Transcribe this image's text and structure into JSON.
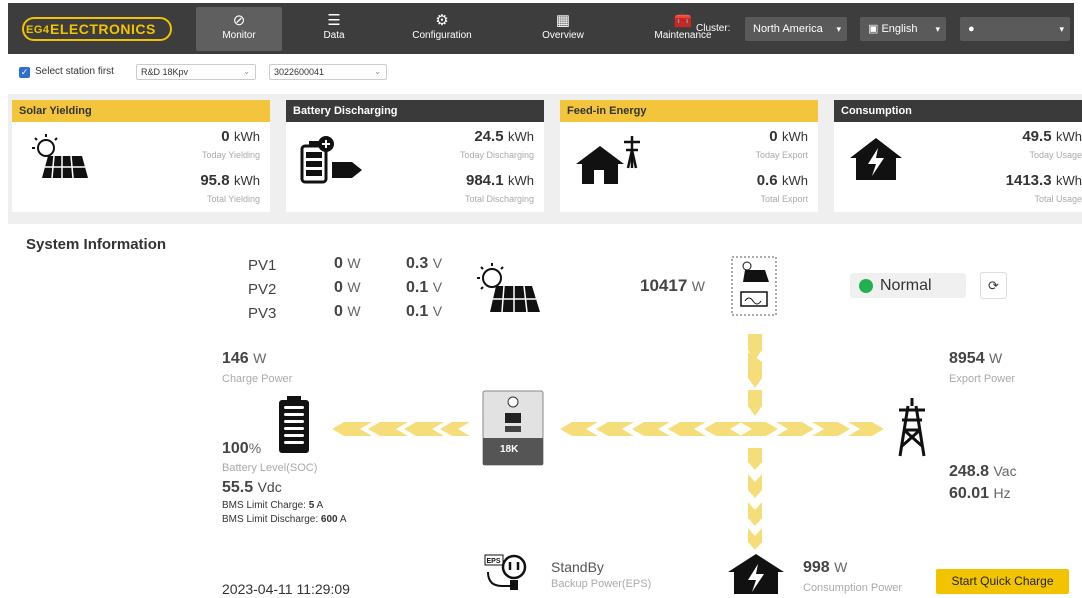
{
  "header": {
    "logo": "ELECTRONICS",
    "logo_mark": "EG4",
    "nav": [
      {
        "label": "Monitor",
        "icon": "⊘"
      },
      {
        "label": "Data",
        "icon": "☰"
      },
      {
        "label": "Configuration",
        "icon": "⚙"
      },
      {
        "label": "Overview",
        "icon": "▦"
      },
      {
        "label": "Maintenance",
        "icon": "🧰"
      }
    ],
    "cluster_label": "Cluster:",
    "cluster_value": "North America",
    "language": "English",
    "account": ""
  },
  "station": {
    "checkbox_label": "Select station first",
    "station": "R&D 18Kpv",
    "serial": "3022600041"
  },
  "cards": [
    {
      "title": "Solar Yielding",
      "today": "0",
      "today_unit": "kWh",
      "today_label": "Today Yielding",
      "total": "95.8",
      "total_unit": "kWh",
      "total_label": "Total Yielding",
      "icon": "solar-panel-icon"
    },
    {
      "title": "Battery Discharging",
      "today": "24.5",
      "today_unit": "kWh",
      "today_label": "Today Discharging",
      "total": "984.1",
      "total_unit": "kWh",
      "total_label": "Total Discharging",
      "icon": "battery-icon"
    },
    {
      "title": "Feed-in Energy",
      "today": "0",
      "today_unit": "kWh",
      "today_label": "Today Export",
      "total": "0.6",
      "total_unit": "kWh",
      "total_label": "Total Export",
      "icon": "house-grid-icon"
    },
    {
      "title": "Consumption",
      "today": "49.5",
      "today_unit": "kWh",
      "today_label": "Today Usage",
      "total": "1413.3",
      "total_unit": "kWh",
      "total_label": "Total Usage",
      "icon": "house-icon"
    }
  ],
  "system": {
    "title": "System Information",
    "pv": [
      {
        "name": "PV1",
        "w": "0",
        "v": "0.3"
      },
      {
        "name": "PV2",
        "w": "0",
        "v": "0.1"
      },
      {
        "name": "PV3",
        "w": "0",
        "v": "0.1"
      }
    ],
    "w_unit": "W",
    "v_unit": "V",
    "pv_total": "10417",
    "status": "Normal",
    "charge_power": "146",
    "charge_label": "Charge Power",
    "battery_level": "100",
    "battery_unit": "%",
    "battery_label": "Battery Level(SOC)",
    "battery_voltage": "55.5",
    "battery_voltage_unit": "Vdc",
    "bms_charge_label": "BMS Limit Charge:",
    "bms_charge": "5",
    "bms_discharge_label": "BMS Limit Discharge:",
    "bms_discharge": "600",
    "bms_unit": "A",
    "export_power": "8954",
    "export_label": "Export Power",
    "grid_voltage": "248.8",
    "grid_voltage_unit": "Vac",
    "grid_freq": "60.01",
    "grid_freq_unit": "Hz",
    "eps_state": "StandBy",
    "eps_label": "Backup Power(EPS)",
    "eps_tag": "EPS",
    "consumption_power": "998",
    "consumption_label": "Consumption Power",
    "inverter_model": "18K",
    "datetime": "2023-04-11 11:29:09",
    "quick_charge": "Start Quick Charge"
  },
  "colors": {
    "accent": "#f2c400",
    "header": "#3d3d3d",
    "status_ok": "#22b14c",
    "flow": "#f5de7a"
  }
}
